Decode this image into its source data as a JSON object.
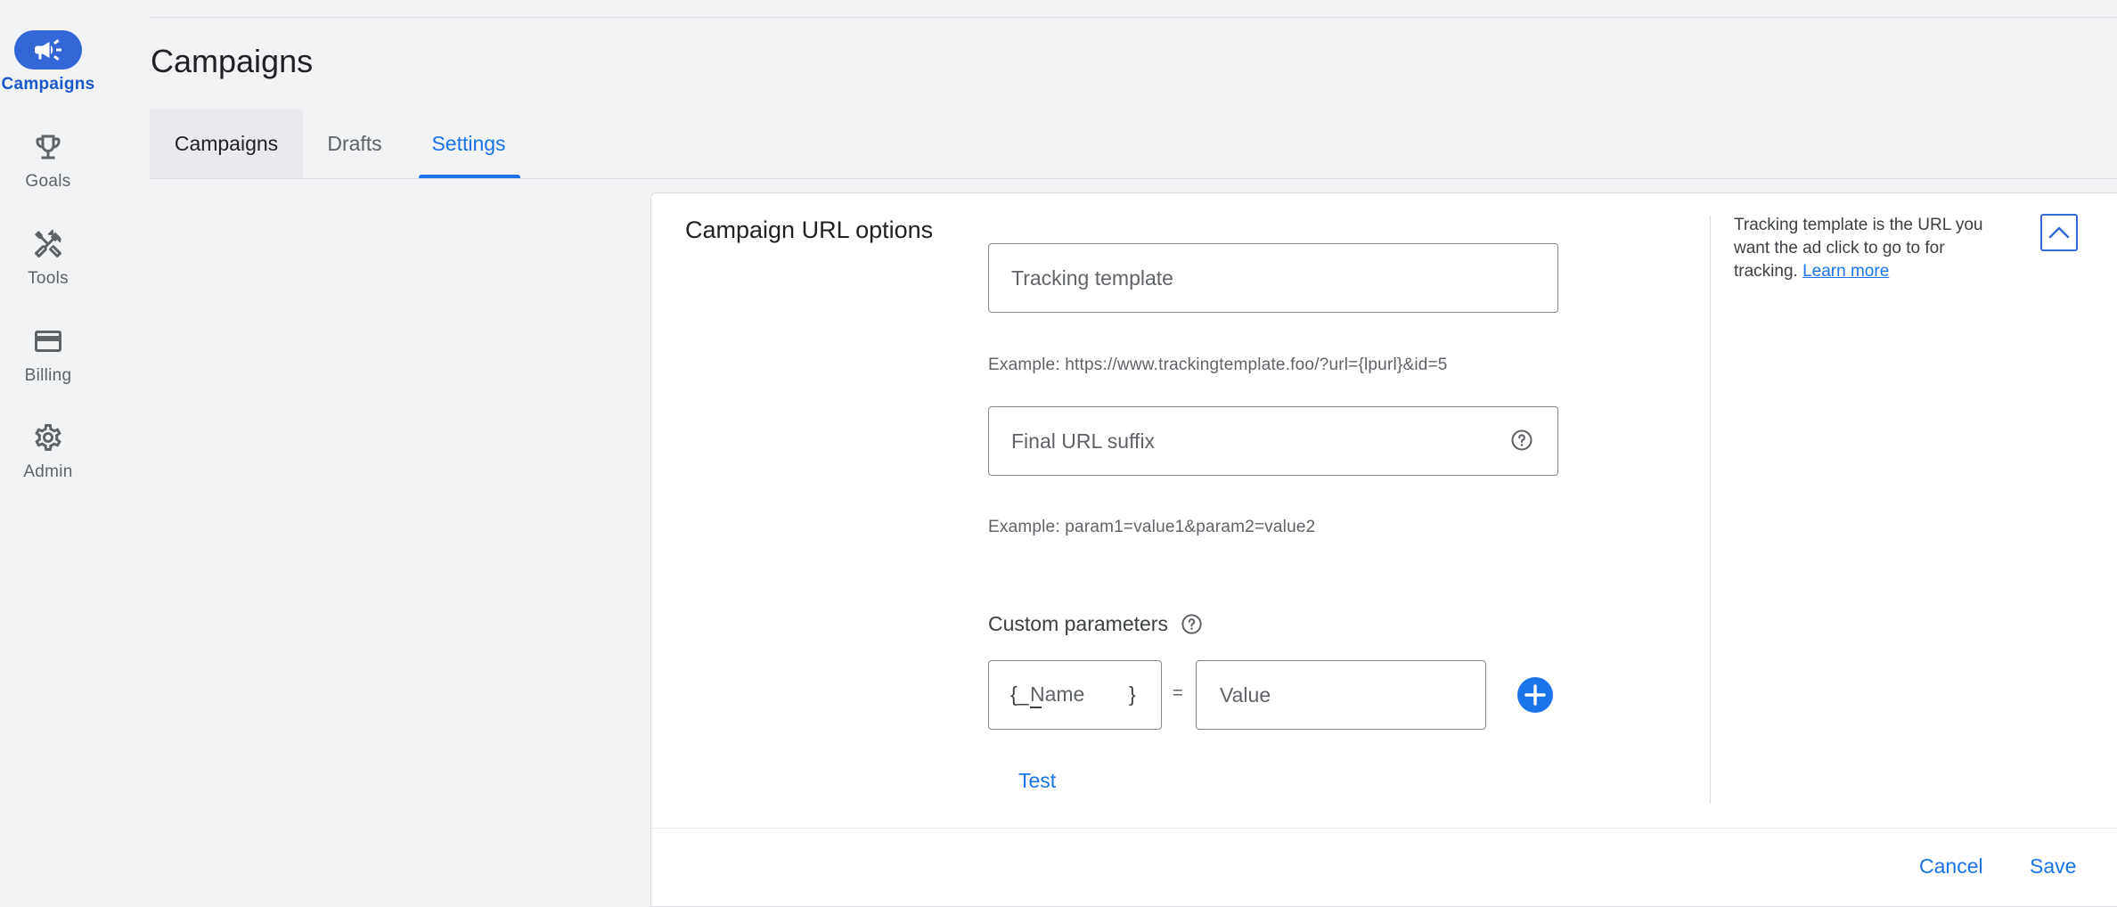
{
  "nav": {
    "items": [
      {
        "label": "Campaigns",
        "icon": "megaphone-icon"
      },
      {
        "label": "Goals",
        "icon": "trophy-icon"
      },
      {
        "label": "Tools",
        "icon": "tools-icon"
      },
      {
        "label": "Billing",
        "icon": "credit-card-icon"
      },
      {
        "label": "Admin",
        "icon": "gear-icon"
      }
    ]
  },
  "page": {
    "title": "Campaigns"
  },
  "tabs": [
    {
      "label": "Campaigns"
    },
    {
      "label": "Drafts"
    },
    {
      "label": "Settings",
      "active": true
    }
  ],
  "card": {
    "title": "Campaign URL options",
    "tracking_template": {
      "placeholder": "Tracking template",
      "example": "Example: https://www.trackingtemplate.foo/?url={lpurl}&id=5"
    },
    "final_url_suffix": {
      "placeholder": "Final URL suffix",
      "example": "Example: param1=value1&param2=value2"
    },
    "custom_parameters": {
      "label": "Custom parameters",
      "brace_open": "{_",
      "name_placeholder": "Name",
      "brace_close": "}",
      "equals": "=",
      "value_placeholder": "Value"
    },
    "test_label": "Test",
    "help_text": "Tracking template is the URL you want the ad click to go to for tracking.",
    "learn_more": "Learn more",
    "cancel_label": "Cancel",
    "save_label": "Save"
  },
  "colors": {
    "accent": "#1a73e8",
    "nav_active": "#3367d6",
    "background": "#f1f3f4"
  }
}
